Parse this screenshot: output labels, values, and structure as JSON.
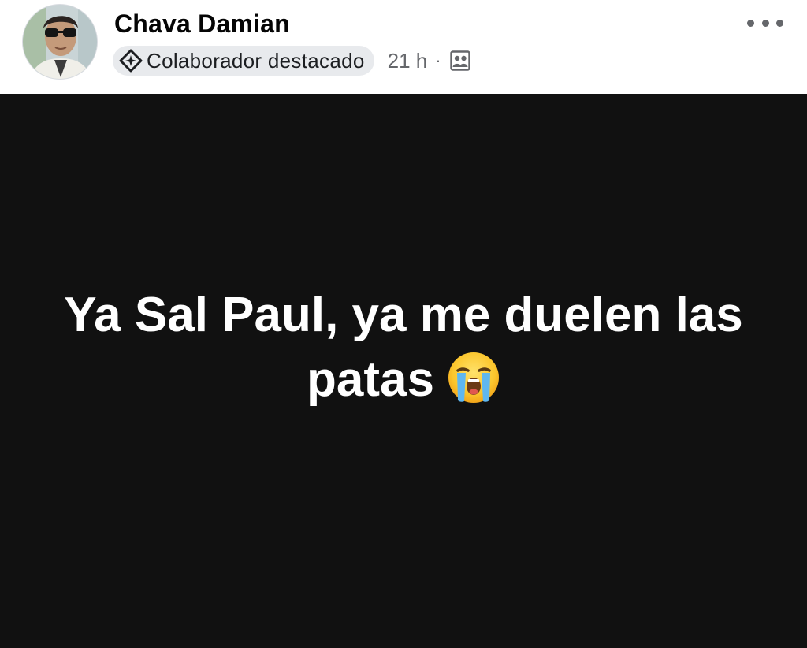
{
  "author": {
    "name": "Chava Damian",
    "avatar_icon": "profile-photo"
  },
  "meta": {
    "badge_icon": "sparkle-diamond-icon",
    "badge_label": "Colaborador destacado",
    "time": "21 h",
    "separator": "·",
    "audience_icon": "group-audience-icon"
  },
  "actions": {
    "more_icon": "more-options-icon"
  },
  "post": {
    "text": "Ya Sal Paul, ya me duelen las patas",
    "emoji": "loudly-crying-face",
    "background_color": "#111111",
    "text_color": "#ffffff"
  }
}
